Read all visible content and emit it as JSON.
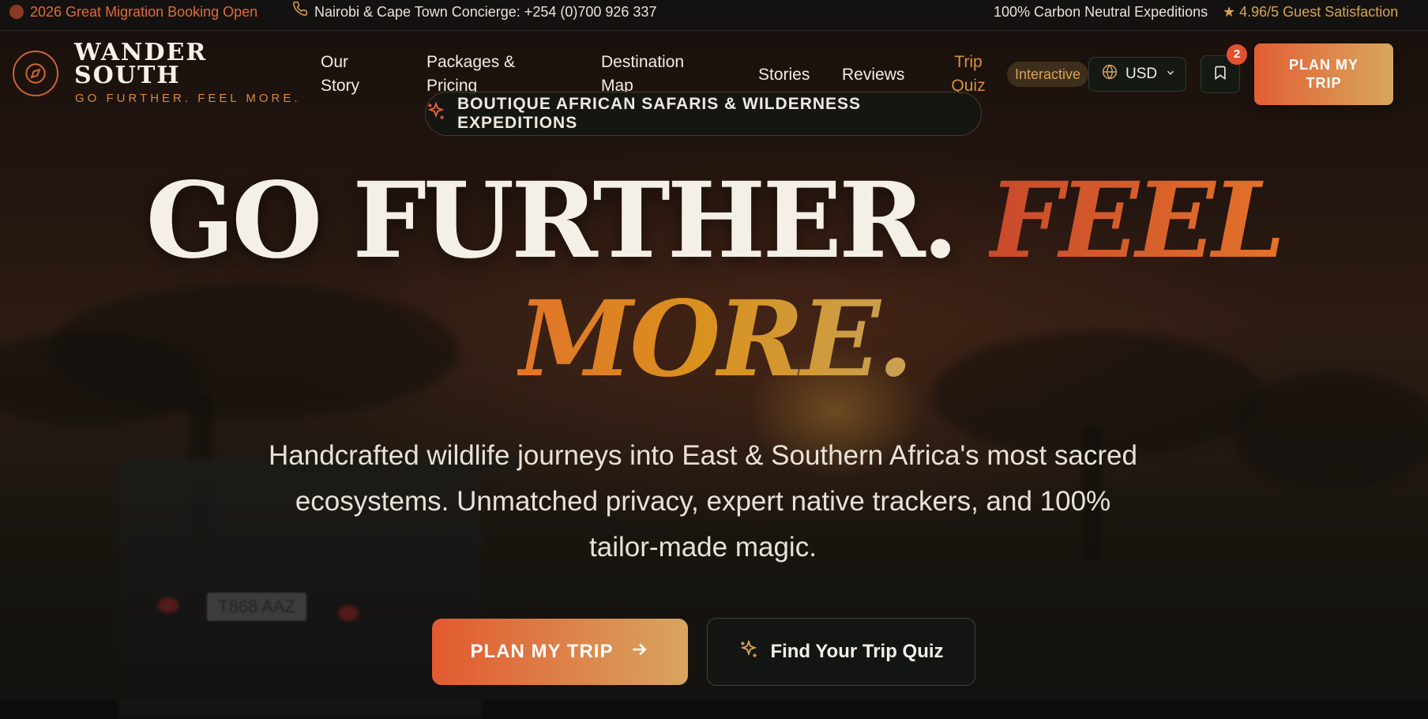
{
  "colors": {
    "accent_orange": "#e25e34",
    "accent_gold": "#d7a35b",
    "background": "#0f0d0b"
  },
  "topbar": {
    "promo": "2026 Great Migration Booking Open",
    "concierge": "Nairobi & Cape Town Concierge: +254 (0)700 926 337",
    "carbon": "100% Carbon Neutral Expeditions",
    "rating": "★ 4.96/5 Guest Satisfaction",
    "icons": [
      "status-dot-icon",
      "phone-icon"
    ]
  },
  "brand": {
    "name": "WANDER SOUTH",
    "tagline": "GO FURTHER. FEEL MORE.",
    "icon": "compass-icon"
  },
  "nav": {
    "links": [
      {
        "label": "Our Story"
      },
      {
        "label": "Packages & Pricing"
      },
      {
        "label": "Destination Map"
      },
      {
        "label": "Stories"
      },
      {
        "label": "Reviews"
      },
      {
        "label": "Trip Quiz"
      }
    ],
    "interactive_badge": "Interactive",
    "currency": "USD",
    "saved_count": "2",
    "plan_button": "PLAN MY TRIP"
  },
  "hero": {
    "eyebrow": "BOUTIQUE AFRICAN SAFARIS & WILDERNESS EXPEDITIONS",
    "headline_part1": "GO FURTHER.",
    "headline_part2": "FEEL MORE.",
    "subtitle": "Handcrafted wildlife journeys into East & Southern Africa's most sacred ecosystems. Unmatched privacy, expert native trackers, and 100% tailor-made magic.",
    "plate_text": "T868 AAZ",
    "primary_cta": "PLAN MY TRIP",
    "secondary_cta": "Find Your Trip Quiz"
  }
}
